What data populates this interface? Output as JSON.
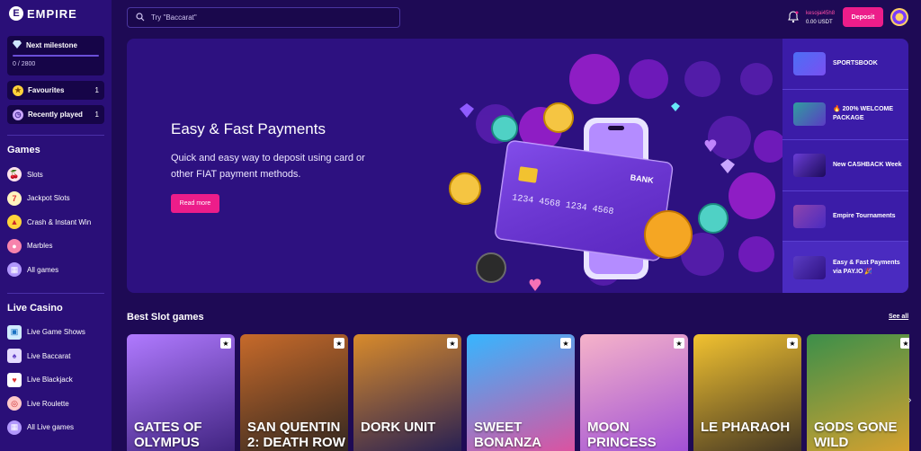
{
  "brand": {
    "name": "EMPIRE",
    "mark": "E"
  },
  "milestone": {
    "title": "Next milestone",
    "progress_text": "0  /  2800",
    "progress": 0.0
  },
  "sidebar_pills": [
    {
      "label": "Favourites",
      "count": "1"
    },
    {
      "label": "Recently played",
      "count": "1"
    }
  ],
  "games_section": {
    "title": "Games",
    "items": [
      {
        "label": "Slots",
        "icon": "cherries-icon"
      },
      {
        "label": "Jackpot Slots",
        "icon": "seven-icon"
      },
      {
        "label": "Crash & Instant Win",
        "icon": "rocket-icon"
      },
      {
        "label": "Marbles",
        "icon": "marbles-icon"
      },
      {
        "label": "All games",
        "icon": "grid-icon"
      }
    ]
  },
  "live_section": {
    "title": "Live Casino",
    "items": [
      {
        "label": "Live Game Shows",
        "icon": "tv-icon"
      },
      {
        "label": "Live Baccarat",
        "icon": "cards-icon"
      },
      {
        "label": "Live Blackjack",
        "icon": "card-icon"
      },
      {
        "label": "Live Roulette",
        "icon": "roulette-icon"
      },
      {
        "label": "All Live games",
        "icon": "grid-icon"
      }
    ]
  },
  "header": {
    "search_placeholder": "Try \"Baccarat\"",
    "username": "kesojai45h8",
    "balance": "0.00 USDT",
    "deposit_label": "Deposit"
  },
  "hero": {
    "title": "Easy & Fast Payments",
    "description": "Quick and easy way to deposit using card or other FIAT payment methods.",
    "button_label": "Read more",
    "card_text": "BANK",
    "card_number": "1234  4568  1234  4568"
  },
  "promos": [
    {
      "label": "SPORTSBOOK",
      "color": "#4c6ef5"
    },
    {
      "label": "🔥 200% WELCOME PACKAGE",
      "color": "#2f9e9e"
    },
    {
      "label": "New CASHBACK Week",
      "color": "#6a3dd6"
    },
    {
      "label": "Empire Tournaments",
      "color": "#8e44ad"
    },
    {
      "label": "Easy & Fast Payments via PAY.IO 🎉",
      "color": "#5b3cc4"
    }
  ],
  "slots": {
    "title": "Best Slot games",
    "see_all": "See all",
    "games": [
      {
        "name": "Gates of Olympus",
        "colors": [
          "#b07aff",
          "#3a1f7a"
        ]
      },
      {
        "name": "San Quentin 2: Death Row",
        "colors": [
          "#c76a2a",
          "#2b2420"
        ]
      },
      {
        "name": "Dork Unit",
        "colors": [
          "#d98b2b",
          "#1e1a55"
        ]
      },
      {
        "name": "Sweet Bonanza",
        "colors": [
          "#35b6ff",
          "#e54d9b"
        ]
      },
      {
        "name": "Moon Princess Trinity",
        "colors": [
          "#f6b3c9",
          "#9c4bd6"
        ]
      },
      {
        "name": "Le Pharaoh",
        "colors": [
          "#f2c230",
          "#3a2f22"
        ]
      },
      {
        "name": "Gods Gone Wild",
        "colors": [
          "#3b8f4a",
          "#e0a22d"
        ]
      }
    ]
  },
  "colors": {
    "accent": "#ec1d8a",
    "sidebar": "#2a0f78",
    "background": "#1e0a55"
  }
}
